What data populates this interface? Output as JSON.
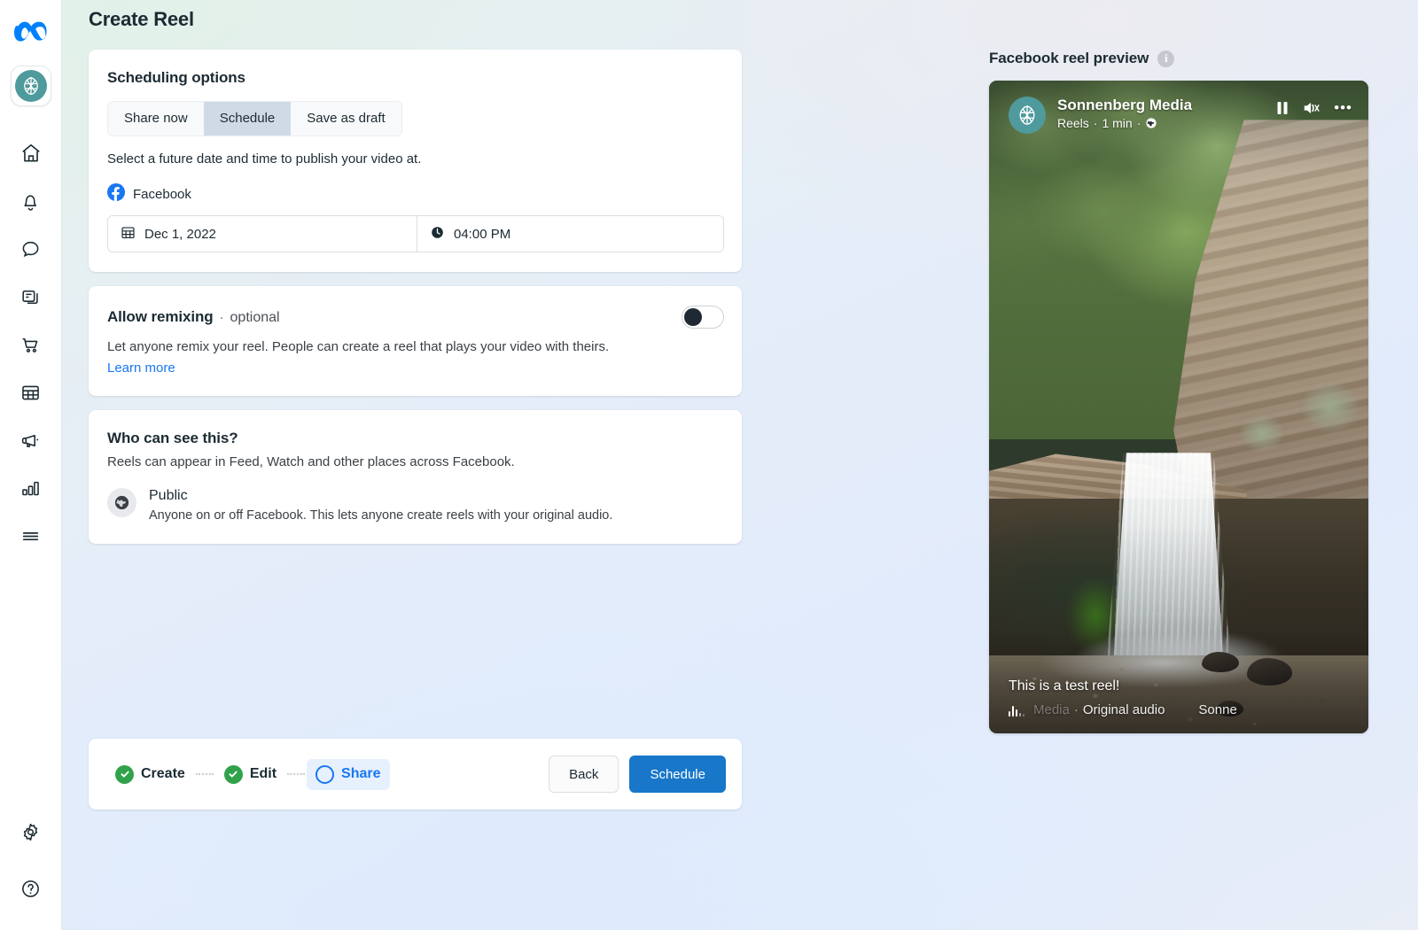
{
  "page": {
    "title": "Create Reel"
  },
  "sidebar": {
    "logo": "meta-logo",
    "avatar_label": "Sonnenberg Media",
    "items": [
      {
        "icon": "home-icon",
        "label": "Home"
      },
      {
        "icon": "bell-icon",
        "label": "Notifications"
      },
      {
        "icon": "chat-bubble-icon",
        "label": "Messages"
      },
      {
        "icon": "posts-icon",
        "label": "Posts"
      },
      {
        "icon": "shopping-cart-icon",
        "label": "Commerce"
      },
      {
        "icon": "grid-table-icon",
        "label": "Planner"
      },
      {
        "icon": "megaphone-icon",
        "label": "Ads"
      },
      {
        "icon": "bar-chart-icon",
        "label": "Insights"
      },
      {
        "icon": "hamburger-menu-icon",
        "label": "More"
      }
    ],
    "bottom_items": [
      {
        "icon": "gear-icon",
        "label": "Settings"
      },
      {
        "icon": "help-circle-icon",
        "label": "Help"
      }
    ]
  },
  "scheduling": {
    "title": "Scheduling options",
    "tabs": [
      {
        "label": "Share now",
        "active": false
      },
      {
        "label": "Schedule",
        "active": true
      },
      {
        "label": "Save as draft",
        "active": false
      }
    ],
    "hint": "Select a future date and time to publish your video at.",
    "channel": "Facebook",
    "channel_icon": "facebook-icon",
    "date_value": "Dec 1, 2022",
    "date_icon": "calendar-icon",
    "time_value": "04:00 PM",
    "time_icon": "clock-icon"
  },
  "remix": {
    "title": "Allow remixing",
    "separator": "·",
    "optional": "optional",
    "description": "Let anyone remix your reel. People can create a reel that plays your video with theirs.",
    "learn_more": "Learn more",
    "toggle_on": false
  },
  "audience": {
    "title": "Who can see this?",
    "subtitle": "Reels can appear in Feed, Watch and other places across Facebook.",
    "option_icon": "globe-icon",
    "option_label": "Public",
    "option_description": "Anyone on or off Facebook. This lets anyone create reels with your original audio."
  },
  "footer": {
    "steps": [
      {
        "label": "Create",
        "state": "done"
      },
      {
        "label": "Edit",
        "state": "done"
      },
      {
        "label": "Share",
        "state": "current"
      }
    ],
    "back_label": "Back",
    "primary_label": "Schedule"
  },
  "preview": {
    "title": "Facebook reel preview",
    "info_icon": "info-icon",
    "info_glyph": "i",
    "page_name": "Sonnenberg Media",
    "meta_type": "Reels",
    "meta_sep1": "·",
    "meta_duration": "1 min",
    "meta_sep2": "·",
    "meta_privacy_icon": "globe-icon",
    "pause_icon": "pause-icon",
    "mute_icon": "speaker-muted-icon",
    "more_icon": "more-options-icon",
    "more_glyph": "•••",
    "caption": "This is a test reel!",
    "audio_icon": "audio-wave-icon",
    "audio_lead": "Media",
    "audio_sep": "·",
    "audio_label": "Original audio",
    "audio_tail": "Sonne"
  },
  "colors": {
    "accent_blue": "#1877f2",
    "primary_button": "#1877c9",
    "brand_teal": "#4f9a9c",
    "success_green": "#31a24c",
    "active_tab": "#cfdae6"
  }
}
